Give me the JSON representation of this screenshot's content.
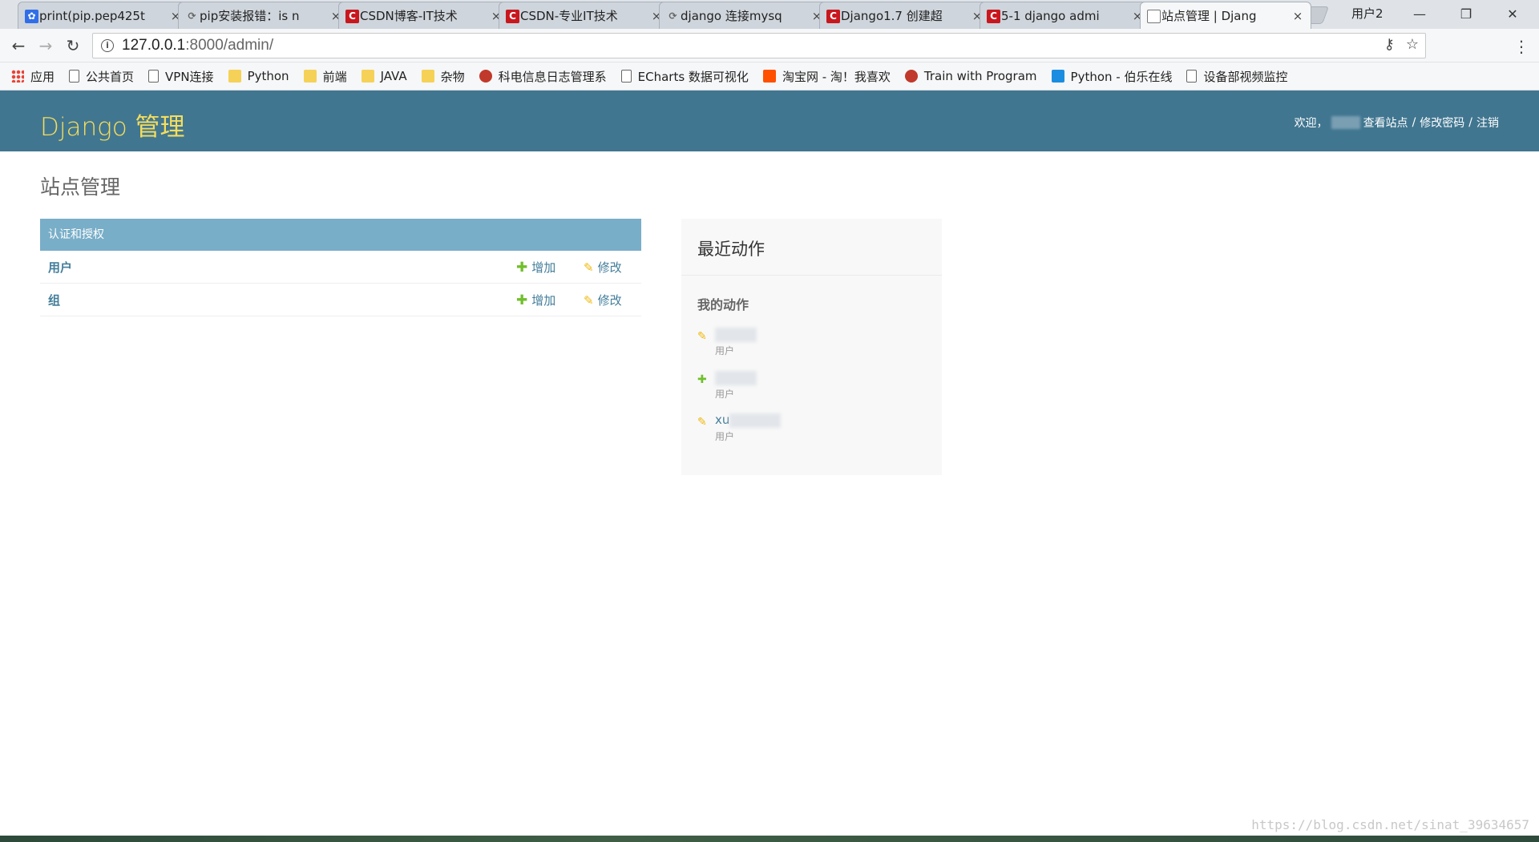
{
  "browser": {
    "tabs": [
      {
        "title": "print(pip.pep425t",
        "icon": "paw-icon",
        "color": "#2f6ee8"
      },
      {
        "title": "pip安装报错：is n",
        "icon": "sync-icon",
        "color": "#666666"
      },
      {
        "title": "CSDN博客-IT技术",
        "icon": "csdn-icon",
        "color": "#c9171e"
      },
      {
        "title": "CSDN-专业IT技术",
        "icon": "csdn-icon",
        "color": "#c9171e"
      },
      {
        "title": "django 连接mysq",
        "icon": "sync-icon",
        "color": "#666666"
      },
      {
        "title": "Django1.7 创建超",
        "icon": "csdn-icon",
        "color": "#c9171e"
      },
      {
        "title": "5-1 django admi",
        "icon": "csdn-icon",
        "color": "#c9171e"
      },
      {
        "title": "站点管理 | Djang",
        "icon": "page-icon",
        "color": "#777777"
      }
    ],
    "tab_close": "×",
    "profile": "用户2",
    "window_controls": {
      "minimize": "—",
      "maximize": "❐",
      "close": "✕"
    },
    "nav": {
      "back": "←",
      "forward": "→",
      "reload": "↻"
    },
    "url_host": "127.0.0.1",
    "url_rest": ":8000/admin/",
    "omni_icons": {
      "key": "⚷",
      "star": "☆"
    },
    "menu": "⋮",
    "bookmarks": [
      {
        "label": "应用",
        "icon": "apps-icon"
      },
      {
        "label": "公共首页",
        "icon": "page-icon"
      },
      {
        "label": "VPN连接",
        "icon": "page-icon"
      },
      {
        "label": "Python",
        "icon": "folder-icon"
      },
      {
        "label": "前端",
        "icon": "folder-icon"
      },
      {
        "label": "JAVA",
        "icon": "folder-icon"
      },
      {
        "label": "杂物",
        "icon": "folder-icon"
      },
      {
        "label": "科电信息日志管理系",
        "icon": "site-icon"
      },
      {
        "label": "ECharts 数据可视化",
        "icon": "page-icon"
      },
      {
        "label": "淘宝网 - 淘！我喜欢",
        "icon": "taobao-icon"
      },
      {
        "label": "Train with Program",
        "icon": "site-icon"
      },
      {
        "label": "Python - 伯乐在线",
        "icon": "bole-icon"
      },
      {
        "label": "设备部视频监控",
        "icon": "page-icon"
      }
    ]
  },
  "admin": {
    "branding": "Django 管理",
    "welcome": "欢迎，",
    "view_site": "查看站点",
    "change_password": "修改密码",
    "logout": "注销",
    "sep": "/",
    "colors": {
      "header": "#417690",
      "branding": "#f5dd5d",
      "caption": "#79aec8",
      "link": "#447e9b",
      "add": "#70bf2b",
      "change": "#efb80b"
    },
    "page_title": "站点管理",
    "app": {
      "caption": "认证和授权",
      "models": [
        {
          "name": "用户",
          "add": "增加",
          "change": "修改"
        },
        {
          "name": "组",
          "add": "增加",
          "change": "修改"
        }
      ]
    },
    "recent": {
      "title": "最近动作",
      "mine": "我的动作",
      "actions": [
        {
          "kind": "change",
          "object": "",
          "type": "用户"
        },
        {
          "kind": "add",
          "object": "",
          "type": "用户"
        },
        {
          "kind": "change",
          "object": "xu",
          "type": "用户"
        }
      ]
    },
    "icons": {
      "add": "✚",
      "change": "✎"
    }
  },
  "watermark": "https://blog.csdn.net/sinat_39634657"
}
